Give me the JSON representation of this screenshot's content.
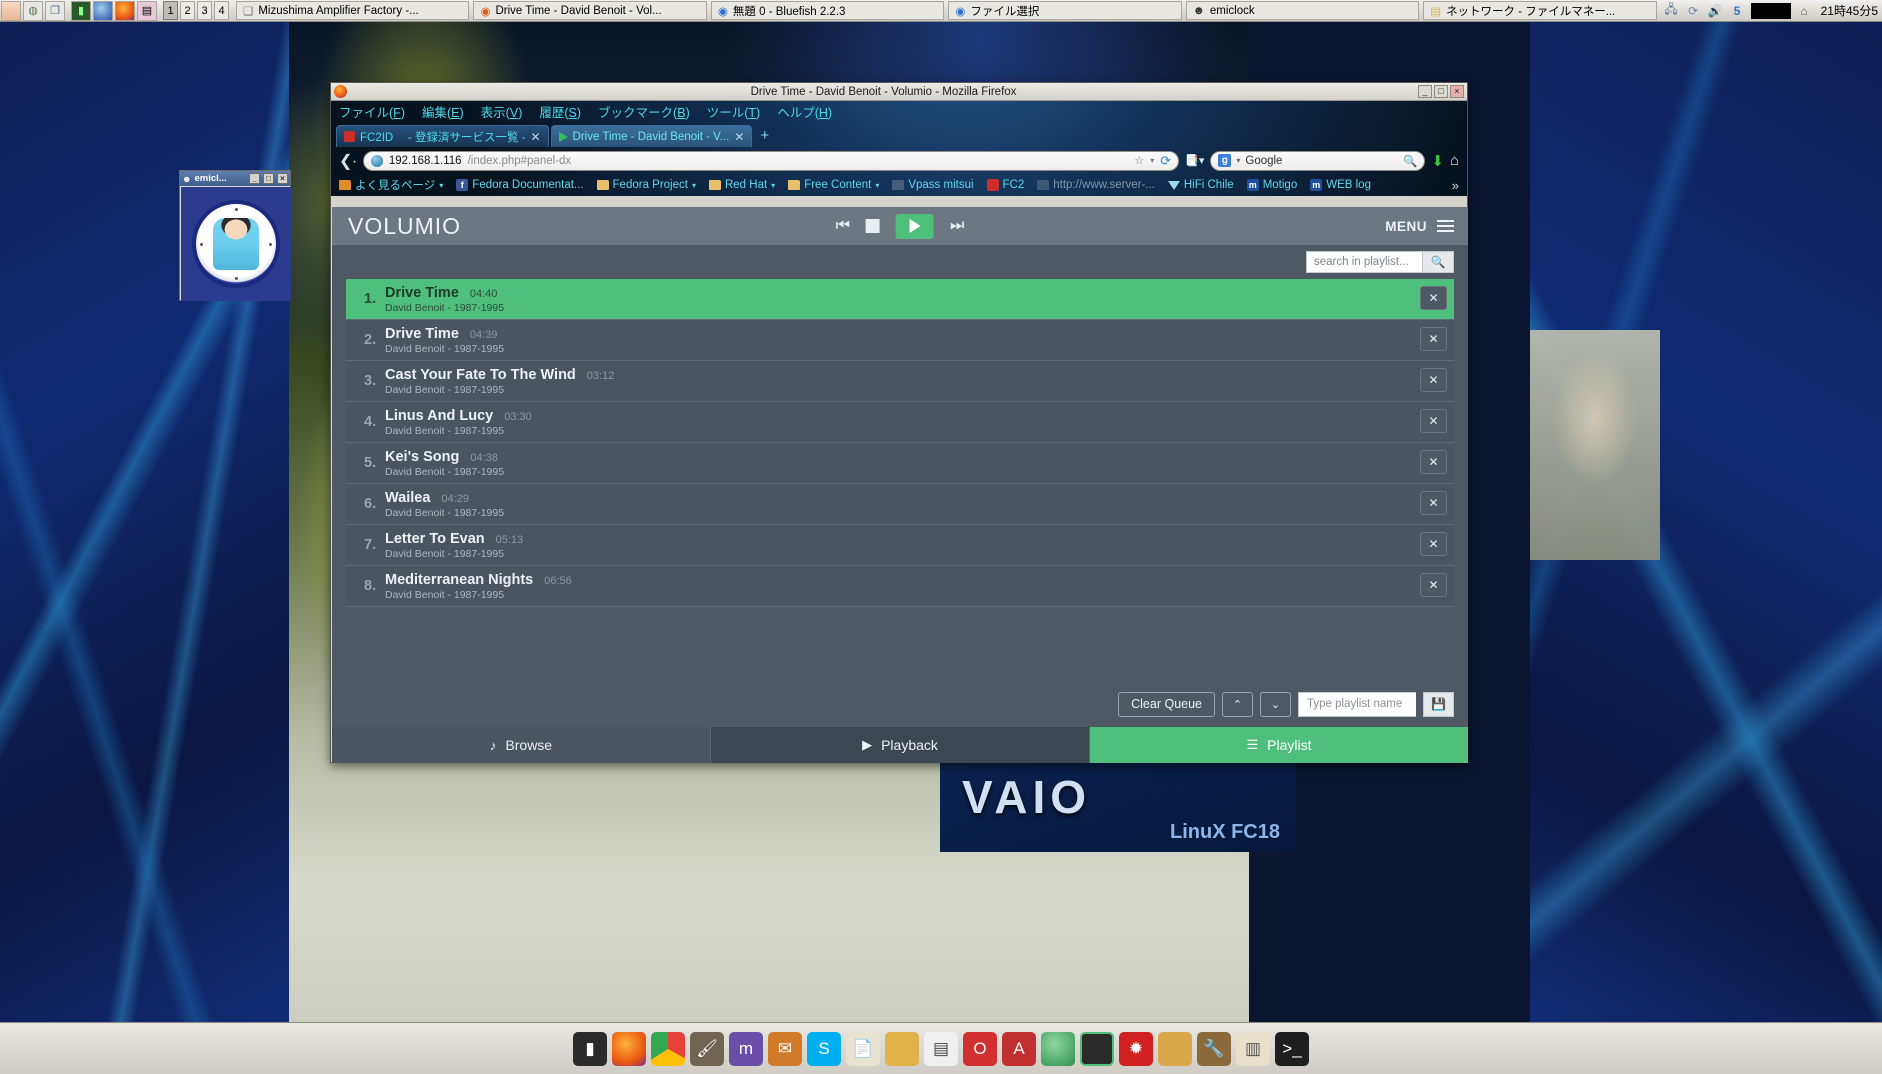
{
  "taskbar": {
    "launchers": [
      "anime-icon",
      "display-icon",
      "windows-icon",
      "terminal-icon",
      "globe-icon",
      "firefox-icon",
      "image-icon"
    ],
    "desktops": [
      "1",
      "2",
      "3",
      "4"
    ],
    "active_desktop": "1",
    "tasks": [
      {
        "label": "Mizushima Amplifier Factory -...",
        "icon": "window-icon"
      },
      {
        "label": "Drive Time - David Benoit - Vol...",
        "icon": "firefox-icon"
      },
      {
        "label": "無題 0 - Bluefish 2.2.3",
        "icon": "bluefish-icon"
      },
      {
        "label": "ファイル選択",
        "icon": "bluefish-icon"
      },
      {
        "label": "emiclock",
        "icon": "emiclock-icon"
      },
      {
        "label": "ネットワーク - ファイルマネー...",
        "icon": "folder-icon"
      }
    ],
    "tray": [
      "network-icon",
      "update-icon",
      "volume-icon",
      "scribus-icon",
      "black-applet"
    ],
    "clock": "21時45分5"
  },
  "emiclock": {
    "title": "emicl...",
    "buttons": [
      "_",
      "□",
      "×"
    ]
  },
  "firefox": {
    "title": "Drive Time - David Benoit - Volumio - Mozilla Firefox",
    "window_buttons": [
      "_",
      "□",
      "×"
    ],
    "menus": [
      {
        "pre": "ファイル(",
        "key": "F",
        "post": ")"
      },
      {
        "pre": "編集(",
        "key": "E",
        "post": ")"
      },
      {
        "pre": "表示(",
        "key": "V",
        "post": ")"
      },
      {
        "pre": "履歴(",
        "key": "S",
        "post": ")"
      },
      {
        "pre": "ブックマーク(",
        "key": "B",
        "post": ")"
      },
      {
        "pre": "ツール(",
        "key": "T",
        "post": ")"
      },
      {
        "pre": "ヘルプ(",
        "key": "H",
        "post": ")"
      }
    ],
    "tabs": [
      {
        "label": "FC2ID 　- 登録済サービス一覧 -",
        "favicon": "fc2-icon",
        "active": false
      },
      {
        "label": "Drive Time - David Benoit - V...",
        "favicon": "play-icon",
        "active": true
      }
    ],
    "new_tab_label": "+",
    "url": "192.168.1.116",
    "url_path": "/index.php#panel-dx",
    "search_placeholder": "Google",
    "bookmarks": [
      {
        "label": "よく見るページ",
        "icon": "folder-orange-icon",
        "caret": true
      },
      {
        "label": "Fedora Documentat...",
        "icon": "facebook-icon",
        "caret": false
      },
      {
        "label": "Fedora Project",
        "icon": "folder-icon",
        "caret": true
      },
      {
        "label": "Red Hat",
        "icon": "folder-icon",
        "caret": true
      },
      {
        "label": "Free Content",
        "icon": "folder-icon",
        "caret": true
      },
      {
        "label": "Vpass mitsui",
        "icon": "blank-icon",
        "caret": false
      },
      {
        "label": "FC2",
        "icon": "fc2-icon",
        "caret": false
      },
      {
        "label": "http://www.server-...",
        "icon": "blank-icon",
        "caret": false
      },
      {
        "label": "HiFi Chile",
        "icon": "triangle-icon",
        "caret": false
      },
      {
        "label": "Motigo",
        "icon": "motigo-icon",
        "caret": false
      },
      {
        "label": "WEB log",
        "icon": "motigo-icon",
        "caret": false
      }
    ],
    "bookmarks_more": "»"
  },
  "volumio": {
    "logo": "VOLUMIO",
    "menu_label": "MENU",
    "transport": [
      "prev-icon",
      "stop-icon",
      "play-icon",
      "next-icon"
    ],
    "search_placeholder": "search in playlist...",
    "tracks": [
      {
        "num": "1.",
        "title": "Drive Time",
        "duration": "04:40",
        "artist": "David Benoit - 1987-1995",
        "playing": true
      },
      {
        "num": "2.",
        "title": "Drive Time",
        "duration": "04:39",
        "artist": "David Benoit - 1987-1995",
        "playing": false
      },
      {
        "num": "3.",
        "title": "Cast Your Fate To The Wind",
        "duration": "03:12",
        "artist": "David Benoit - 1987-1995",
        "playing": false
      },
      {
        "num": "4.",
        "title": "Linus And Lucy",
        "duration": "03:30",
        "artist": "David Benoit - 1987-1995",
        "playing": false
      },
      {
        "num": "5.",
        "title": "Kei's Song",
        "duration": "04:38",
        "artist": "David Benoit - 1987-1995",
        "playing": false
      },
      {
        "num": "6.",
        "title": "Wailea",
        "duration": "04:29",
        "artist": "David Benoit - 1987-1995",
        "playing": false
      },
      {
        "num": "7.",
        "title": "Letter To Evan",
        "duration": "05:13",
        "artist": "David Benoit - 1987-1995",
        "playing": false
      },
      {
        "num": "8.",
        "title": "Mediterranean Nights",
        "duration": "06:56",
        "artist": "David Benoit - 1987-1995",
        "playing": false
      }
    ],
    "remove_label": "✕",
    "clear_queue_label": "Clear Queue",
    "sort_up_label": "⌃",
    "sort_down_label": "⌄",
    "playlist_name_placeholder": "Type playlist name",
    "save_icon": "save-icon",
    "tabs": [
      {
        "label": "Browse",
        "icon": "music-note-icon",
        "state": "normal"
      },
      {
        "label": "Playback",
        "icon": "play-icon",
        "state": "dark"
      },
      {
        "label": "Playlist",
        "icon": "list-icon",
        "state": "active"
      }
    ]
  },
  "desktop": {
    "vaio_logo": "VAIO",
    "vaio_sub": "LinuX FC18"
  },
  "dock": {
    "items": [
      "terminal-icon",
      "firefox-icon",
      "chrome-icon",
      "gimp-icon",
      "music-icon",
      "mail-icon",
      "skype-icon",
      "notes-icon",
      "folder-icon",
      "document-icon",
      "opera-icon",
      "adobe-icon",
      "globe-icon",
      "volumio-icon",
      "sunrise-icon",
      "folder2-icon",
      "tools-icon",
      "files-icon",
      "console-icon"
    ]
  },
  "colors": {
    "volumio_green": "#4ec07c",
    "volumio_bg": "#4f5963",
    "firefox_chrome": "#123055"
  }
}
